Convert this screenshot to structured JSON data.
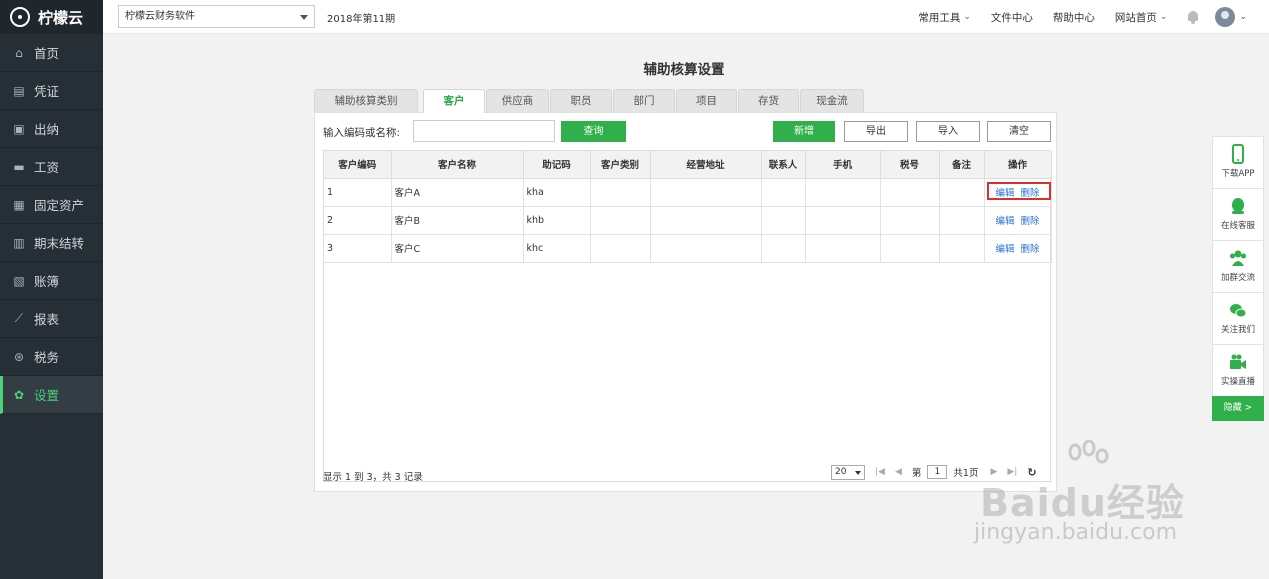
{
  "app": {
    "logo_text": "柠檬云"
  },
  "sidebar": {
    "items": [
      {
        "label": "首页",
        "icon": "home-icon",
        "glyph": "⌂"
      },
      {
        "label": "凭证",
        "icon": "voucher-icon",
        "glyph": "▤"
      },
      {
        "label": "出纳",
        "icon": "cashier-icon",
        "glyph": "▣"
      },
      {
        "label": "工资",
        "icon": "wage-icon",
        "glyph": "▬"
      },
      {
        "label": "固定资产",
        "icon": "building-icon",
        "glyph": "▦"
      },
      {
        "label": "期末结转",
        "icon": "calendar-icon",
        "glyph": "▥"
      },
      {
        "label": "账簿",
        "icon": "book-icon",
        "glyph": "▧"
      },
      {
        "label": "报表",
        "icon": "chart-icon",
        "glyph": "⟋"
      },
      {
        "label": "税务",
        "icon": "tax-icon",
        "glyph": "⊛"
      },
      {
        "label": "设置",
        "icon": "gear-icon",
        "glyph": "✿"
      }
    ],
    "active_index": 9,
    "accent_color": "#4cd07a"
  },
  "topbar": {
    "company": "柠檬云财务软件",
    "period": "2018年第11期",
    "links": {
      "tools": "常用工具",
      "files": "文件中心",
      "help": "帮助中心",
      "site": "网站首页"
    }
  },
  "page": {
    "title": "辅助核算设置"
  },
  "tabs": [
    {
      "label": "辅助核算类别"
    },
    {
      "label": "客户"
    },
    {
      "label": "供应商"
    },
    {
      "label": "职员"
    },
    {
      "label": "部门"
    },
    {
      "label": "项目"
    },
    {
      "label": "存货"
    },
    {
      "label": "现金流"
    }
  ],
  "filter": {
    "label": "输入编码或名称:",
    "value": "",
    "search_button": "查询"
  },
  "actions": {
    "add": "新增",
    "export": "导出",
    "import": "导入",
    "clear": "清空"
  },
  "table": {
    "columns": [
      "客户编码",
      "客户名称",
      "助记码",
      "客户类别",
      "经营地址",
      "联系人",
      "手机",
      "税号",
      "备注",
      "操作"
    ],
    "rows": [
      {
        "code": "1",
        "name": "客户A",
        "mnemonic": "kha",
        "category": "",
        "address": "",
        "contact": "",
        "phone": "",
        "tax_no": "",
        "remark": ""
      },
      {
        "code": "2",
        "name": "客户B",
        "mnemonic": "khb",
        "category": "",
        "address": "",
        "contact": "",
        "phone": "",
        "tax_no": "",
        "remark": ""
      },
      {
        "code": "3",
        "name": "客户C",
        "mnemonic": "khc",
        "category": "",
        "address": "",
        "contact": "",
        "phone": "",
        "tax_no": "",
        "remark": ""
      }
    ],
    "edit_label": "编辑",
    "delete_label": "删除"
  },
  "footer": {
    "info": "显示 1 到 3，共 3 记录",
    "page_size": "20",
    "page_prefix": "第",
    "page_number": "1",
    "page_total": "共1页"
  },
  "float_bar": {
    "items": [
      {
        "label": "下载APP",
        "icon": "phone-icon"
      },
      {
        "label": "在线客服",
        "icon": "service-icon"
      },
      {
        "label": "加群交流",
        "icon": "group-icon"
      },
      {
        "label": "关注我们",
        "icon": "wechat-icon"
      },
      {
        "label": "实操直播",
        "icon": "video-icon"
      }
    ],
    "hide_label": "隐藏 >"
  },
  "watermark": {
    "main": "Baidu经验",
    "sub": "jingyan.baidu.com"
  },
  "colors": {
    "sidebar_bg": "#262e36",
    "primary_green": "#2fb04a",
    "link_blue": "#2a70d6",
    "highlight_red": "#d9302d"
  }
}
